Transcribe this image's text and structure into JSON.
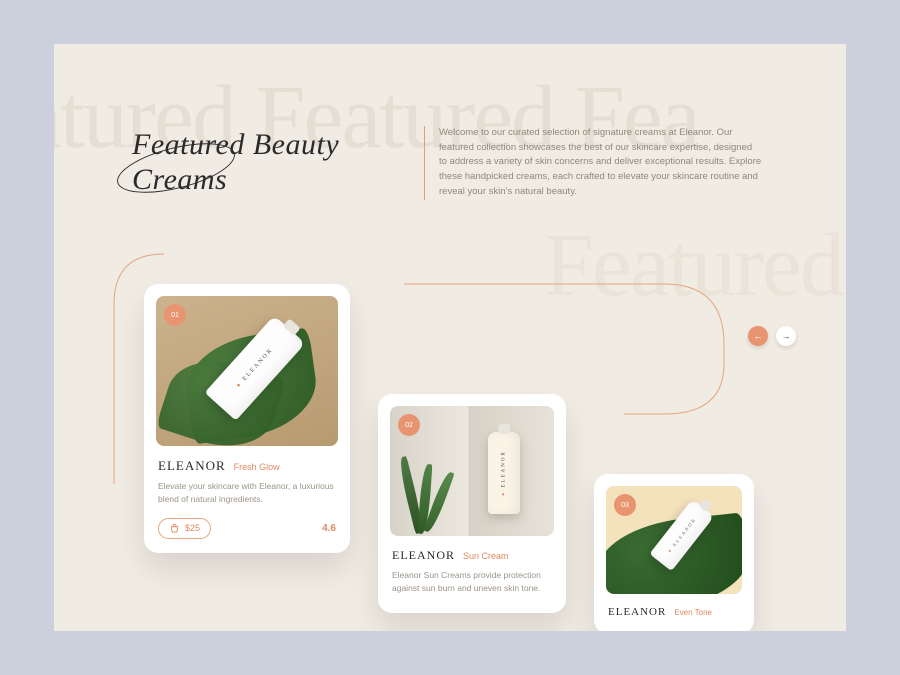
{
  "marquee": "eatured Featured Fea",
  "marquee2": "Featured",
  "heading": {
    "line1": "Featured Beauty",
    "line2": "Creams"
  },
  "intro": "Welcome to our curated selection of signature creams at Eleanor. Our featured collection showcases the best of our skincare expertise, designed to address a variety of skin concerns and deliver exceptional results. Explore these handpicked creams, each crafted to elevate your skincare routine and reveal your skin's natural beauty.",
  "colors": {
    "accent": "#e89470"
  },
  "nav": {
    "prev_glyph": "←",
    "next_glyph": "→"
  },
  "tube_brand": "ELEANOR",
  "products": [
    {
      "badge": "01",
      "brand": "ELEANOR",
      "variant": "Fresh Glow",
      "desc": "Elevate your skincare with Eleanor, a luxurious blend of natural ingredients.",
      "price": "$25",
      "rating": "4.6"
    },
    {
      "badge": "02",
      "brand": "ELEANOR",
      "variant": "Sun Cream",
      "desc": "Eleanor Sun Creams provide protection against sun burn and uneven skin tone."
    },
    {
      "badge": "03",
      "brand": "ELEANOR",
      "variant": "Even Tone"
    }
  ]
}
